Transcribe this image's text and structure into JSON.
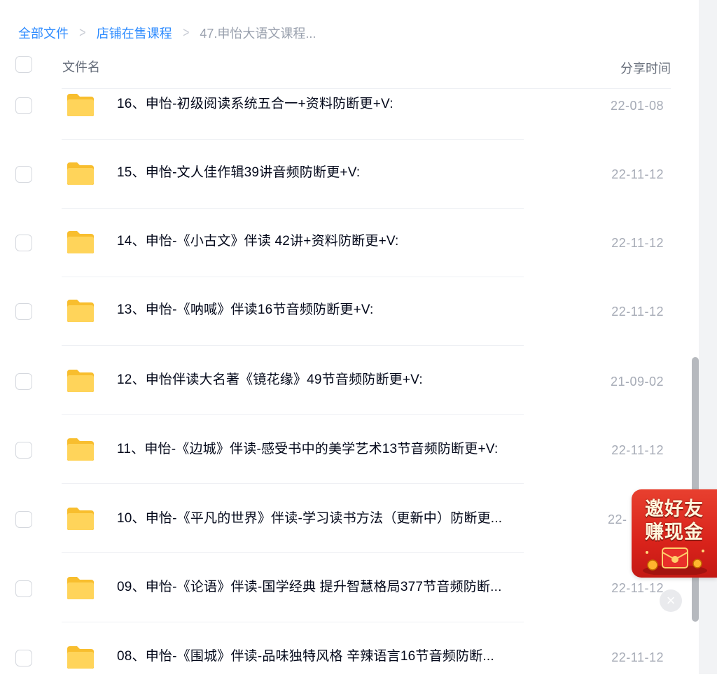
{
  "breadcrumb": {
    "items": [
      "全部文件",
      "店铺在售课程"
    ],
    "current": "47.申怡大语文课程...",
    "separator": ">"
  },
  "table": {
    "col_name": "文件名",
    "col_time": "分享时间",
    "rows": [
      {
        "name": "16、申怡-初级阅读系统五合一+资料防断更+V:",
        "time": "22-01-08"
      },
      {
        "name": "15、申怡-文人佳作辑39讲音频防断更+V:",
        "time": "22-11-12"
      },
      {
        "name": "14、申怡-《小古文》伴读 42讲+资料防断更+V:",
        "time": "22-11-12"
      },
      {
        "name": "13、申怡-《呐喊》伴读16节音频防断更+V:",
        "time": "22-11-12"
      },
      {
        "name": "12、申怡伴读大名著《镜花缘》49节音频防断更+V:",
        "time": "21-09-02"
      },
      {
        "name": "11、申怡-《边城》伴读-感受书中的美学艺术13节音频防断更+V:",
        "time": "22-11-12"
      },
      {
        "name": "10、申怡-《平凡的世界》伴读-学习读书方法（更新中）防断更...",
        "time": "22-"
      },
      {
        "name": "09、申怡-《论语》伴读-国学经典 提升智慧格局377节音频防断...",
        "time": "22-11-12"
      },
      {
        "name": "08、申怡-《围城》伴读-品味独特风格 辛辣语言16节音频防断...",
        "time": "22-11-12"
      }
    ]
  },
  "invite_badge": {
    "line1": "邀好友",
    "line2": "赚现金",
    "close": "×"
  },
  "icons": {
    "folder": "folder-icon",
    "close": "close-icon"
  },
  "colors": {
    "link": "#2f8cff",
    "folder": "#ffcf48",
    "badge": "#d9231b"
  }
}
